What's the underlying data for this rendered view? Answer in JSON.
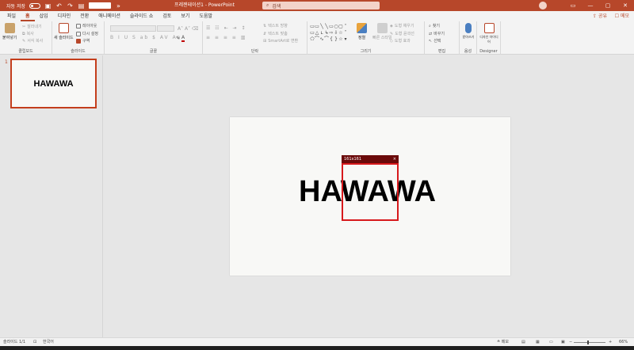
{
  "titlebar": {
    "autosave_label": "자동 저장",
    "doc_title": "프레젠테이션1  -  PowerPoint",
    "search_placeholder": "검색",
    "user_initial": "",
    "minimize": "—",
    "restore": "▢",
    "close": "✕",
    "ribbon_display": "▭"
  },
  "tabs": [
    "파일",
    "홈",
    "삽입",
    "디자인",
    "전환",
    "애니메이션",
    "슬라이드 쇼",
    "검토",
    "보기",
    "도움말"
  ],
  "tabs_active": "홈",
  "share_label": "공유",
  "comments_label": "메모",
  "ribbon": {
    "clipboard": {
      "paste": "붙여넣기",
      "cut": "잘라내기",
      "copy": "복사",
      "format_painter": "서식 복사",
      "label": "클립보드"
    },
    "slides": {
      "new_slide": "새 슬라이드",
      "layout": "레이아웃",
      "reset": "다시 설정",
      "section": "구역",
      "label": "슬라이드"
    },
    "font": {
      "label": "글꼴"
    },
    "paragraph": {
      "text_direction": "텍스트 방향",
      "align_text": "텍스트 맞춤",
      "smartart": "SmartArt로 변환",
      "label": "단락"
    },
    "drawing": {
      "arrange": "정렬",
      "quick_styles": "빠른 스타일",
      "shape_fill": "도형 채우기",
      "shape_outline": "도형 윤곽선",
      "shape_effects": "도형 효과",
      "label": "그리기"
    },
    "editing": {
      "find": "찾기",
      "replace": "바꾸기",
      "select": "선택",
      "label": "편집"
    },
    "voice": {
      "dictate": "받아쓰기",
      "label": "음성"
    },
    "designer": {
      "design_ideas": "디자인 아이디어",
      "label": "Designer"
    }
  },
  "thumbnail": {
    "number": "1",
    "text": "HAWAWA"
  },
  "slide": {
    "text": "HAWAWA"
  },
  "overlay": {
    "size_label": "161x161",
    "close": "×"
  },
  "statusbar": {
    "slide_info": "슬라이드 1/1",
    "language": "한국어",
    "notes": "메모",
    "zoom": "66%"
  },
  "colors": {
    "accent": "#b7472a",
    "selection": "#d7191c"
  }
}
